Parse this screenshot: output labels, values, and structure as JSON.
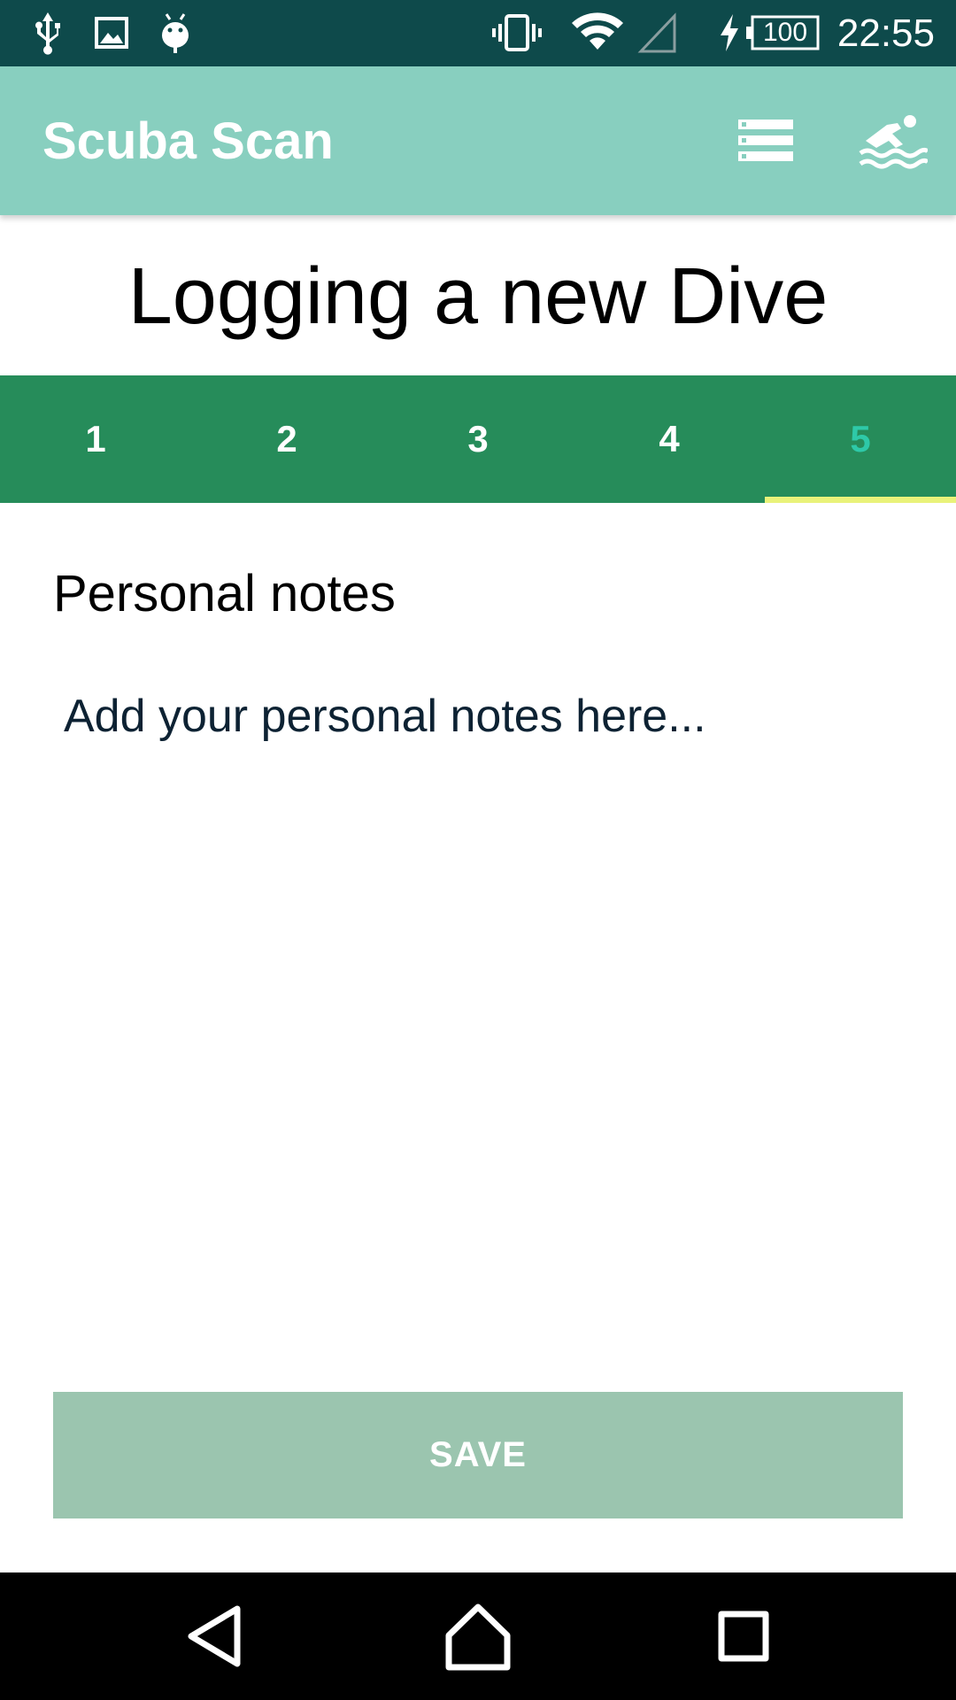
{
  "status_bar": {
    "time": "22:55",
    "battery_level": "100",
    "left_icons": [
      "usb-icon",
      "image-icon",
      "android-debug-icon"
    ],
    "right_icons": [
      "vibrate-icon",
      "wifi-icon",
      "cell-signal-icon",
      "charging-icon",
      "battery-icon"
    ]
  },
  "app_bar": {
    "title": "Scuba Scan",
    "actions": [
      "list-icon",
      "swimmer-icon"
    ],
    "background_color": "#88cfbf"
  },
  "page": {
    "heading": "Logging a new Dive"
  },
  "tabs": {
    "items": [
      {
        "label": "1",
        "active": false
      },
      {
        "label": "2",
        "active": false
      },
      {
        "label": "3",
        "active": false
      },
      {
        "label": "4",
        "active": false
      },
      {
        "label": "5",
        "active": true
      }
    ],
    "background_color": "#268c5a",
    "active_text_color": "#2ec9a8",
    "indicator_color": "#e9f27a"
  },
  "notes": {
    "label": "Personal notes",
    "value": "",
    "placeholder": "Add your personal notes here..."
  },
  "save_button": {
    "label": "SAVE",
    "color": "#9bc5af"
  },
  "nav_bar": {
    "icons": [
      "back-icon",
      "home-icon",
      "recents-icon"
    ]
  }
}
